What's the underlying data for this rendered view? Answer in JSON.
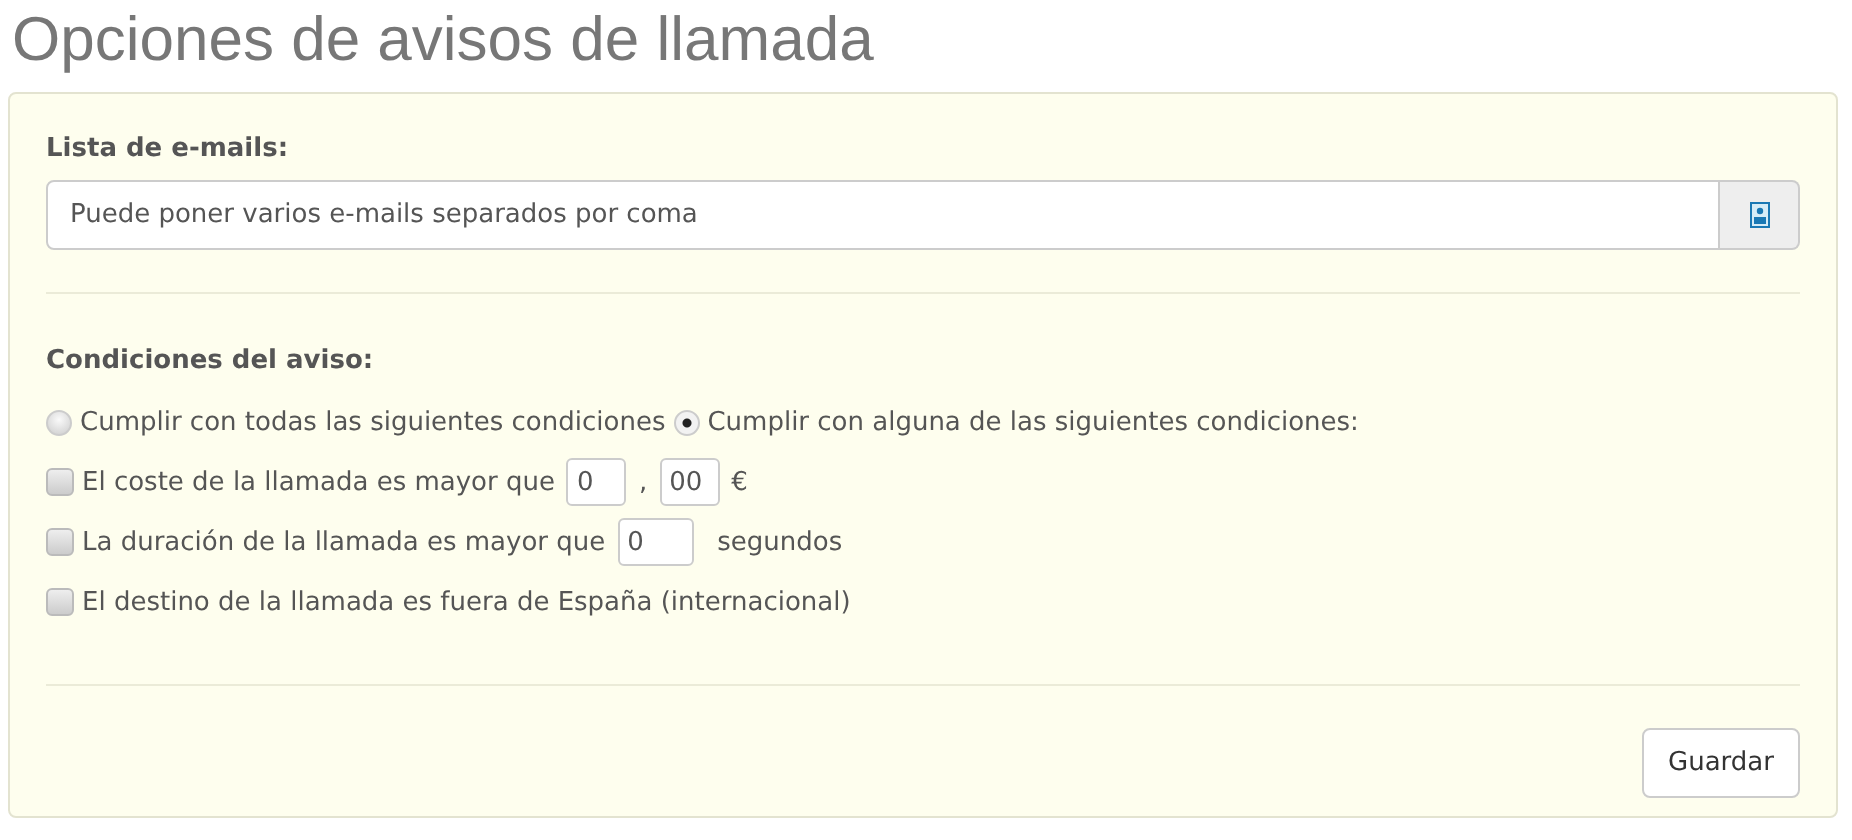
{
  "title": "Opciones de avisos de llamada",
  "emails": {
    "label": "Lista de e-mails:",
    "placeholder": "Puede poner varios e-mails separados por coma"
  },
  "conditions": {
    "label": "Condiciones del aviso:",
    "match_options": [
      {
        "label": "Cumplir con todas las siguientes condiciones",
        "selected": false
      },
      {
        "label": "Cumplir con alguna de las siguientes condiciones:",
        "selected": true
      }
    ],
    "rules": [
      {
        "checked": false,
        "parts": [
          {
            "kind": "text",
            "text": "El coste de la llamada es mayor que"
          },
          {
            "kind": "input",
            "value": "0"
          },
          {
            "kind": "text",
            "text": ","
          },
          {
            "kind": "input",
            "value": "00"
          },
          {
            "kind": "text",
            "text": "€"
          }
        ]
      },
      {
        "checked": false,
        "parts": [
          {
            "kind": "text",
            "text": "La duración de la llamada es mayor que"
          },
          {
            "kind": "long_input",
            "value": "0"
          },
          {
            "kind": "text",
            "text": "segundos"
          }
        ]
      },
      {
        "checked": false,
        "parts": [
          {
            "kind": "text",
            "text": "El destino de la llamada es fuera de España (internacional)"
          }
        ]
      }
    ]
  },
  "save_button": "Guardar"
}
